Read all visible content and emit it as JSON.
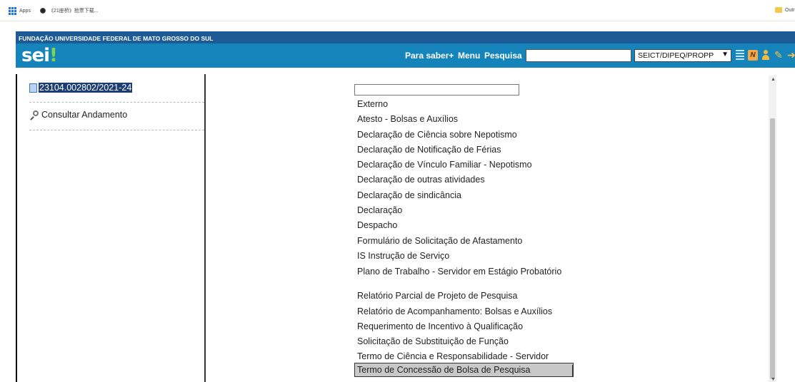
{
  "browser": {
    "bookmarks": {
      "apps_label": "Apps",
      "site_label": "《21座桥》抢票下载...",
      "other_label": "Outr"
    }
  },
  "header": {
    "institution": "FUNDAÇÃO UNIVERSIDADE FEDERAL DE MATO GROSSO DO SUL",
    "logo_text": "sei",
    "logo_dot": "!",
    "nav": {
      "saber": "Para saber+",
      "menu": "Menu",
      "pesquisa": "Pesquisa"
    },
    "search_value": "",
    "unit": "SEICT/DIPEQ/PROPP",
    "icons": [
      "list-icon",
      "notification-n-icon",
      "user-icon",
      "tools-icon",
      "exit-icon"
    ],
    "colors": {
      "top_bar": "#1e5a95",
      "header": "#1584bb",
      "logo_accent": "#7fd44a"
    }
  },
  "sidebar": {
    "process_number": "23104.002802/2021-24",
    "consult_label": "Consultar Andamento"
  },
  "main": {
    "filter_value": "",
    "document_types": [
      "Externo",
      "Atesto - Bolsas e Auxílios",
      "Declaração de Ciência sobre Nepotismo",
      "Declaração de Notificação de Férias",
      "Declaração de Vínculo Familiar - Nepotismo",
      "Declaração de outras atividades",
      "Declaração de sindicância",
      "Declaração",
      "Despacho",
      "Formulário de Solicitação de Afastamento",
      "IS Instrução de Serviço",
      "Plano de Trabalho - Servidor em Estágio Probatório",
      "Relatório Parcial de Projeto de Pesquisa",
      "Relatório de Acompanhamento: Bolsas e Auxílios",
      "Requerimento de Incentivo à Qualificação",
      "Solicitação de Substituição de Função",
      "Termo de Ciência e Responsabilidade - Servidor"
    ],
    "selected_document": "Termo de Concessão de Bolsa de Pesquisa"
  }
}
